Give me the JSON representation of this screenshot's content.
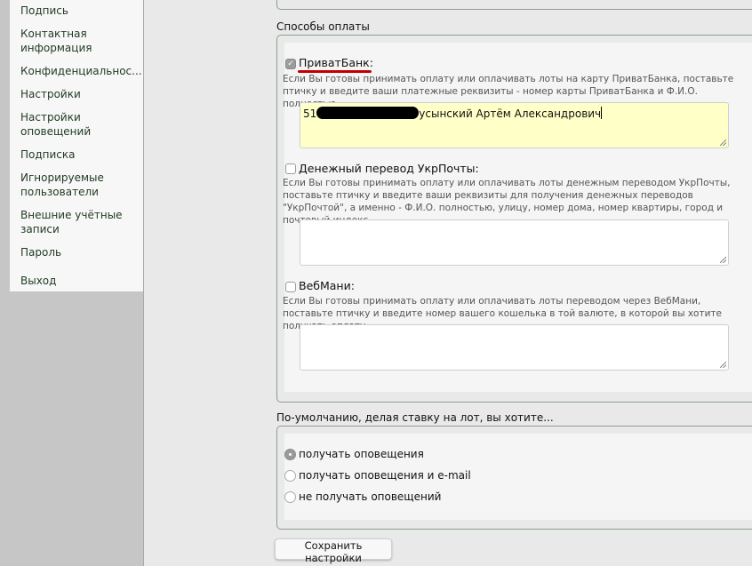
{
  "sidebar": {
    "items": [
      {
        "label": "Подпись"
      },
      {
        "label": "Контактная информация"
      },
      {
        "label": "Конфиденциальнос..."
      },
      {
        "label": "Настройки"
      },
      {
        "label": "Настройки оповещений"
      },
      {
        "label": "Подписка"
      },
      {
        "label": "Игнорируемые пользователи"
      },
      {
        "label": "Внешние учётные записи"
      },
      {
        "label": "Пароль"
      },
      {
        "label": "Выход"
      }
    ]
  },
  "payment": {
    "legend": "Способы оплаты",
    "methods": [
      {
        "label": "ПриватБанк:",
        "checked": true,
        "desc": "Если Вы готовы принимать оплату или оплачивать лоты на карту ПриватБанка, поставьте птичку и введите ваши платежные реквизиты - номер карты ПриватБанка и Ф.И.О. полностью.",
        "value_prefix": "51",
        "value_suffix": "усынский Артём Александрович"
      },
      {
        "label": "Денежный перевод УкрПочты:",
        "checked": false,
        "desc": "Если Вы готовы принимать оплату или оплачивать лоты денежным переводом УкрПочты, поставьте птичку и введите ваши реквизиты для получения денежных переводов \"УкрПочтой\", а именно - Ф.И.О. полностью, улицу, номер дома, номер квартиры, город и почтовый индекс.",
        "value": ""
      },
      {
        "label": "ВебМани:",
        "checked": false,
        "desc": "Если Вы готовы принимать оплату или оплачивать лоты переводом через ВебМани, поставьте птичку и введите номер вашего кошелька в той валюте, в которой вы хотите получать оплату.",
        "value": ""
      }
    ]
  },
  "bid_default": {
    "legend": "По-умолчанию, делая ставку на лот, вы хотите...",
    "options": [
      {
        "label": "получать оповещения",
        "selected": true
      },
      {
        "label": "получать оповещения и e-mail",
        "selected": false
      },
      {
        "label": "не получать оповещений",
        "selected": false
      }
    ]
  },
  "save_label": "Сохранить настройки",
  "colors": {
    "highlight": "#ffffc8",
    "annotation": "#c00000",
    "sidebar_text": "#1f3a22"
  }
}
